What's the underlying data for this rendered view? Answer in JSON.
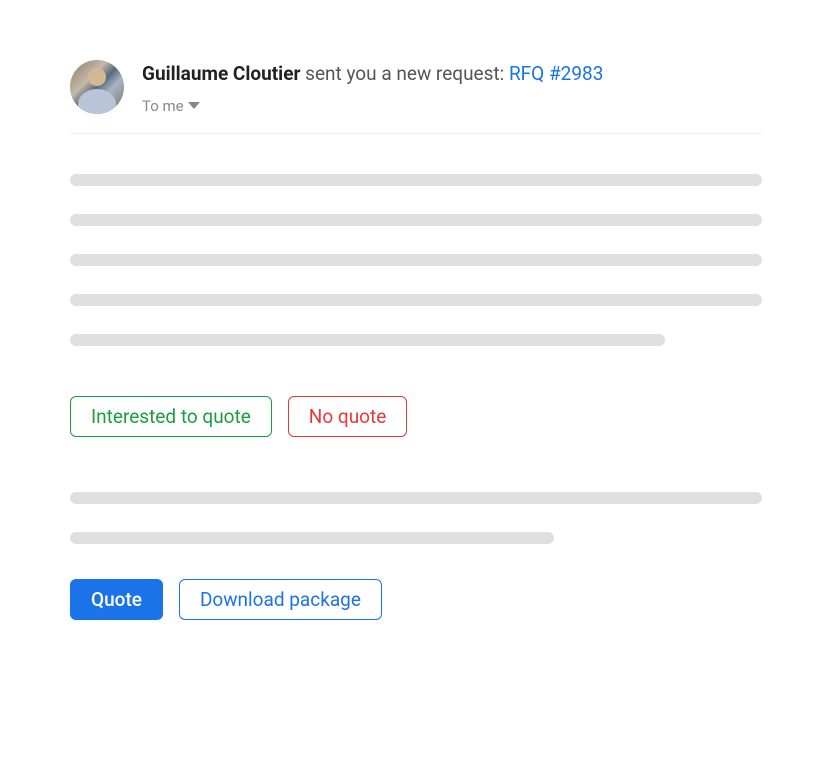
{
  "header": {
    "sender_name": "Guillaume Cloutier",
    "subject_suffix": " sent you a new request: ",
    "request_link": "RFQ #2983",
    "to_label": "To me"
  },
  "actions": {
    "interested_label": "Interested to quote",
    "no_quote_label": "No quote",
    "quote_label": "Quote",
    "download_label": "Download package"
  }
}
